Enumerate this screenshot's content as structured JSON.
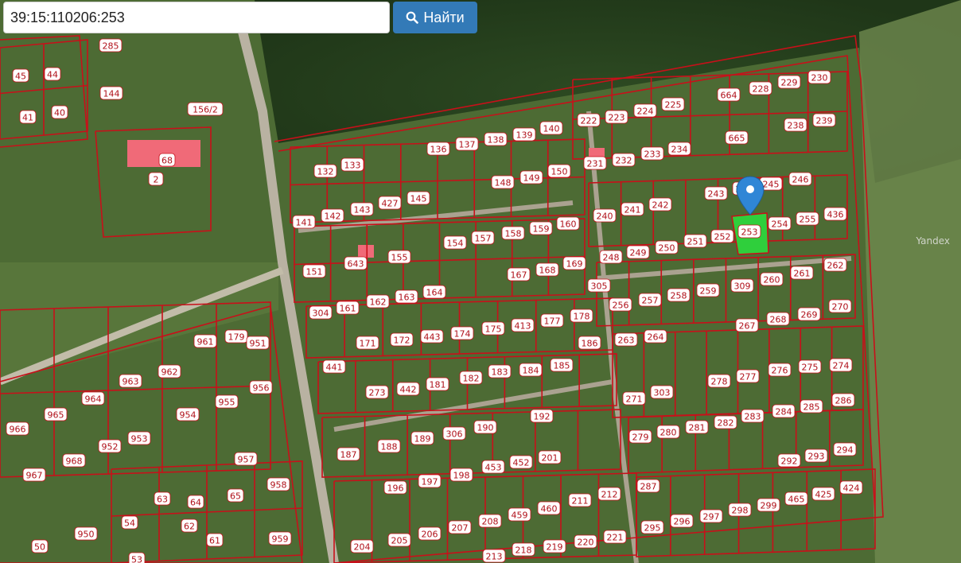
{
  "search": {
    "value": "39:15:110206:253",
    "button_label": "Найти",
    "button_icon": "search-icon"
  },
  "attribution": "Yandex",
  "map": {
    "selected_parcel": "253",
    "marker_icon": "map-pin-icon",
    "colors": {
      "boundary": "#c8101a",
      "label_bg": "#ffffff",
      "label_text": "#b0101a",
      "selected_fill": "#2fcf3c",
      "marker": "#2f86d6",
      "building": "#f06a78"
    },
    "labels": [
      "285",
      "45",
      "44",
      "144",
      "41",
      "40",
      "156/2",
      "68",
      "2",
      "664",
      "228",
      "229",
      "230",
      "222",
      "223",
      "224",
      "225",
      "665",
      "238",
      "239",
      "136",
      "137",
      "138",
      "139",
      "140",
      "231",
      "232",
      "233",
      "234",
      "132",
      "133",
      "150",
      "148",
      "149",
      "243",
      "244",
      "245",
      "246",
      "141",
      "142",
      "143",
      "427",
      "145",
      "240",
      "241",
      "242",
      "253",
      "254",
      "255",
      "436",
      "151",
      "643",
      "155",
      "154",
      "157",
      "158",
      "159",
      "160",
      "248",
      "249",
      "250",
      "251",
      "252",
      "262",
      "167",
      "168",
      "169",
      "305",
      "309",
      "260",
      "261",
      "304",
      "161",
      "162",
      "163",
      "164",
      "256",
      "257",
      "258",
      "259",
      "270",
      "267",
      "268",
      "269",
      "961",
      "179",
      "951",
      "441",
      "171",
      "172",
      "443",
      "174",
      "175",
      "413",
      "177",
      "178",
      "263",
      "264",
      "186",
      "962",
      "963",
      "964",
      "965",
      "273",
      "442",
      "181",
      "182",
      "183",
      "184",
      "185",
      "271",
      "303",
      "278",
      "277",
      "276",
      "275",
      "274",
      "955",
      "956",
      "954",
      "966",
      "953",
      "952",
      "968",
      "967",
      "957",
      "958",
      "187",
      "188",
      "189",
      "306",
      "190",
      "192",
      "201",
      "453",
      "452",
      "286",
      "285",
      "284",
      "283",
      "282",
      "281",
      "280",
      "279",
      "294",
      "293",
      "292",
      "196",
      "197",
      "198",
      "63",
      "64",
      "65",
      "62",
      "54",
      "950",
      "50",
      "53",
      "61",
      "959",
      "204",
      "205",
      "206",
      "207",
      "208",
      "459",
      "460",
      "211",
      "212",
      "287",
      "295",
      "296",
      "297",
      "298",
      "299",
      "465",
      "425",
      "424",
      "213",
      "218",
      "219",
      "220",
      "221"
    ]
  }
}
